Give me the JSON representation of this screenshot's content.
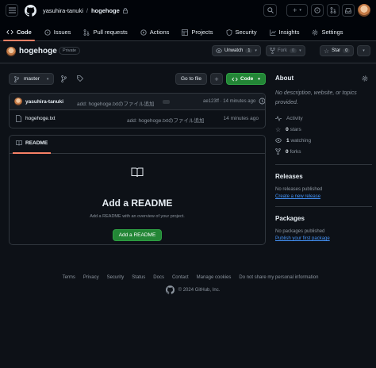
{
  "header": {
    "owner": "yasuhira-tanuki",
    "separator": "/",
    "repo": "hogehoge",
    "tabs": [
      {
        "label": "Code",
        "icon": "code-icon"
      },
      {
        "label": "Issues",
        "icon": "issue-icon"
      },
      {
        "label": "Pull requests",
        "icon": "pull-request-icon"
      },
      {
        "label": "Actions",
        "icon": "play-icon"
      },
      {
        "label": "Projects",
        "icon": "table-icon"
      },
      {
        "label": "Security",
        "icon": "shield-icon"
      },
      {
        "label": "Insights",
        "icon": "graph-icon"
      },
      {
        "label": "Settings",
        "icon": "gear-icon"
      }
    ]
  },
  "repo": {
    "name": "hogehoge",
    "visibility": "Private",
    "watch": {
      "label": "Unwatch",
      "count": "1"
    },
    "fork": {
      "label": "Fork",
      "count": "0"
    },
    "star": {
      "label": "Star",
      "count": "0"
    }
  },
  "toolbar": {
    "branch": "master",
    "goto": "Go to file",
    "add": "+",
    "code": "Code"
  },
  "commit": {
    "author": "yasuhira-tanuki",
    "message": "add: hogehoge.txtのファイル追加",
    "sha": "ae123ff · 14 minutes ago"
  },
  "files": [
    {
      "name": "hogehoge.txt",
      "message": "add: hogehoge.txtのファイル追加",
      "time": "14 minutes ago"
    }
  ],
  "readme": {
    "tab": "README",
    "title": "Add a README",
    "subtitle": "Add a README with an overview of your project.",
    "button": "Add a README"
  },
  "about": {
    "title": "About",
    "description": "No description, website, or topics provided.",
    "activity": "Activity",
    "stars_count": "0",
    "stars_label": "stars",
    "watching_count": "1",
    "watching_label": "watching",
    "forks_count": "0",
    "forks_label": "forks"
  },
  "releases": {
    "title": "Releases",
    "empty": "No releases published",
    "link": "Create a new release"
  },
  "packages": {
    "title": "Packages",
    "empty": "No packages published",
    "link": "Publish your first package"
  },
  "footer": {
    "links": [
      "Terms",
      "Privacy",
      "Security",
      "Status",
      "Docs",
      "Contact",
      "Manage cookies",
      "Do not share my personal information"
    ],
    "copyright": "© 2024 GitHub, Inc."
  },
  "colors": {
    "accent": "#f78166",
    "green": "#238636",
    "link": "#4493f8",
    "bg": "#0d1117"
  }
}
